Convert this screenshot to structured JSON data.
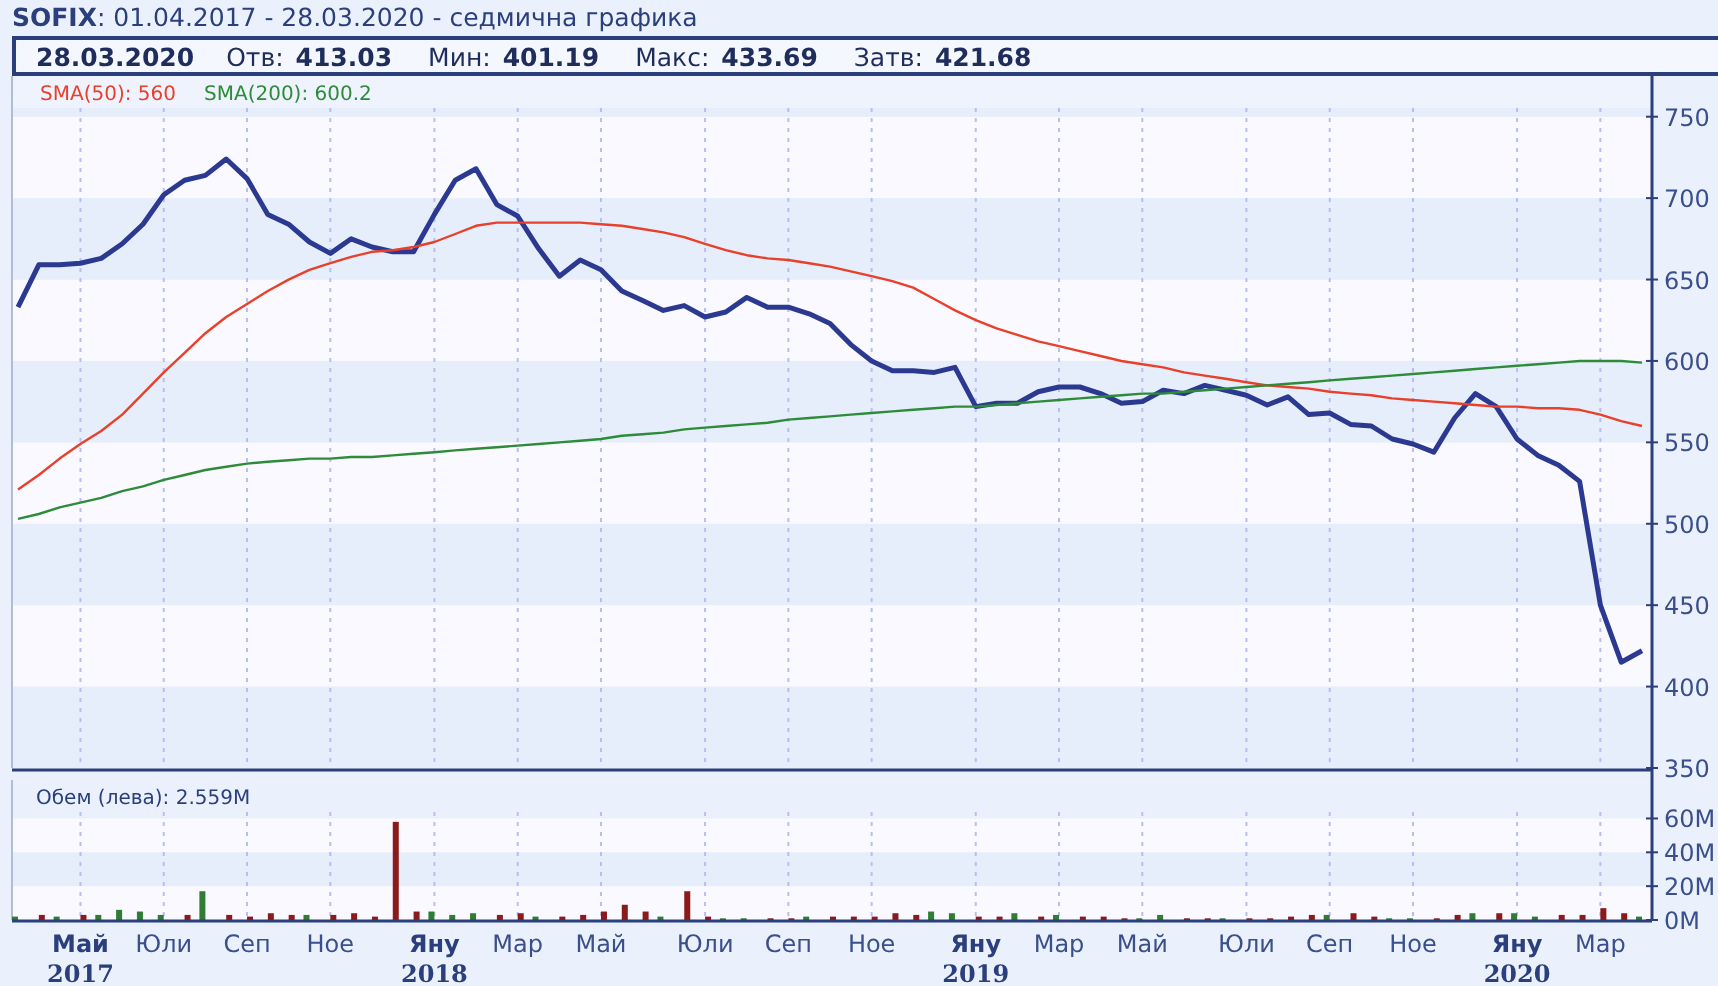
{
  "title": "**SOFIX**: 01.04.2017 - 28.03.2020 - седмична графика",
  "quote": {
    "date": "28.03.2020",
    "fields": [
      {
        "label": "Отв:",
        "value": "413.03"
      },
      {
        "label": "Мин:",
        "value": "401.19"
      },
      {
        "label": "Макс:",
        "value": "433.69"
      },
      {
        "label": "Затв:",
        "value": "421.68"
      }
    ]
  },
  "price_panel": {
    "legend": [
      {
        "text": "SMA(50): 560",
        "color": "#e8402a"
      },
      {
        "text": "SMA(200): 600.2",
        "color": "#2e8b3a"
      }
    ],
    "chart_data": {
      "type": "line",
      "grid": true,
      "ylim": [
        350,
        775
      ],
      "yticks": [
        350,
        400,
        450,
        500,
        550,
        600,
        650,
        700,
        750
      ],
      "series": [
        {
          "color": "#2b3990",
          "values": [
            633,
            659,
            659,
            660,
            663,
            672,
            684,
            702,
            711,
            714,
            724,
            712,
            690,
            684,
            673,
            666,
            675,
            670,
            667,
            667,
            690,
            711,
            718,
            696,
            689,
            669,
            652,
            662,
            656,
            643,
            637,
            631,
            634,
            627,
            630,
            639,
            633,
            633,
            629,
            623,
            610,
            600,
            594,
            594,
            593,
            596,
            572,
            574,
            574,
            581,
            584,
            584,
            580,
            574,
            575,
            582,
            580,
            585,
            582,
            579,
            573,
            578,
            567,
            568,
            561,
            560,
            552,
            549,
            544,
            565,
            580,
            572,
            552,
            542,
            536,
            526,
            450,
            415,
            422
          ]
        },
        {
          "color": "#e8402a",
          "values": [
            521,
            530,
            540,
            549,
            557,
            567,
            580,
            593,
            605,
            617,
            627,
            635,
            643,
            650,
            656,
            660,
            664,
            667,
            668,
            670,
            673,
            678,
            683,
            685,
            685,
            685,
            685,
            685,
            684,
            683,
            681,
            679,
            676,
            672,
            668,
            665,
            663,
            662,
            660,
            658,
            655,
            652,
            649,
            645,
            638,
            631,
            625,
            620,
            616,
            612,
            609,
            606,
            603,
            600,
            598,
            596,
            593,
            591,
            589,
            587,
            585,
            584,
            583,
            581,
            580,
            579,
            577,
            576,
            575,
            574,
            573,
            572,
            572,
            571,
            571,
            570,
            567,
            563,
            560
          ]
        },
        {
          "color": "#2e8b3a",
          "values": [
            503,
            506,
            510,
            513,
            516,
            520,
            523,
            527,
            530,
            533,
            535,
            537,
            538,
            539,
            540,
            540,
            541,
            541,
            542,
            543,
            544,
            545,
            546,
            547,
            548,
            549,
            550,
            551,
            552,
            554,
            555,
            556,
            558,
            559,
            560,
            561,
            562,
            564,
            565,
            566,
            567,
            568,
            569,
            570,
            571,
            572,
            572,
            573,
            574,
            575,
            576,
            577,
            578,
            579,
            580,
            580,
            581,
            582,
            583,
            584,
            585,
            586,
            587,
            588,
            589,
            590,
            591,
            592,
            593,
            594,
            595,
            596,
            597,
            598,
            599,
            600,
            600,
            600,
            599
          ]
        }
      ]
    }
  },
  "volume_panel": {
    "legend": "Обем (лева): 2.559M",
    "chart_data": {
      "type": "bar",
      "grid": true,
      "ylim": [
        0,
        65
      ],
      "yticks": [
        {
          "value": 0,
          "label": "0M"
        },
        {
          "value": 20,
          "label": "20M"
        },
        {
          "value": 40,
          "label": "40M"
        },
        {
          "value": 60,
          "label": "60M"
        }
      ],
      "categories": [
        null,
        null,
        null,
        "Май\n2017",
        null,
        null,
        null,
        "Юли",
        null,
        null,
        null,
        "Сеп",
        null,
        null,
        null,
        "Ное",
        null,
        null,
        null,
        null,
        "Яну\n2018",
        null,
        null,
        null,
        "Мар",
        null,
        null,
        null,
        "Май",
        null,
        null,
        null,
        null,
        "Юли",
        null,
        null,
        null,
        "Сеп",
        null,
        null,
        null,
        "Ное",
        null,
        null,
        null,
        null,
        "Яну\n2019",
        null,
        null,
        null,
        "Мар",
        null,
        null,
        null,
        "Май",
        null,
        null,
        null,
        null,
        "Юли",
        null,
        null,
        null,
        "Сеп",
        null,
        null,
        null,
        "Ное",
        null,
        null,
        null,
        null,
        "Яну\n2020",
        null,
        null,
        null,
        "Мар",
        null,
        null
      ],
      "series": [
        {
          "color": "#2e7d32",
          "values": [
            2,
            null,
            2,
            null,
            3,
            6,
            5,
            3,
            null,
            17,
            null,
            null,
            null,
            null,
            3,
            null,
            null,
            null,
            null,
            null,
            5,
            3,
            4,
            null,
            null,
            2,
            null,
            null,
            null,
            null,
            null,
            2,
            null,
            null,
            1,
            1,
            null,
            null,
            2,
            null,
            null,
            null,
            null,
            null,
            5,
            4,
            null,
            null,
            4,
            null,
            3,
            null,
            null,
            null,
            1,
            3,
            null,
            null,
            1,
            null,
            null,
            null,
            null,
            3,
            null,
            null,
            1,
            1,
            null,
            null,
            4,
            null,
            4,
            2,
            null,
            null,
            null,
            null,
            2
          ]
        },
        {
          "color": "#8b1a1a",
          "values": [
            null,
            3,
            null,
            3,
            null,
            null,
            null,
            null,
            3,
            null,
            3,
            2,
            4,
            3,
            null,
            3,
            4,
            2,
            58,
            5,
            null,
            null,
            null,
            3,
            4,
            null,
            2,
            3,
            5,
            9,
            5,
            null,
            17,
            2,
            null,
            null,
            1,
            1,
            null,
            2,
            2,
            2,
            4,
            3,
            null,
            null,
            2,
            2,
            null,
            2,
            null,
            2,
            2,
            1,
            null,
            null,
            1,
            1,
            null,
            1,
            1,
            2,
            3,
            null,
            4,
            2,
            null,
            null,
            1,
            3,
            null,
            4,
            null,
            null,
            3,
            3,
            7,
            4,
            null
          ]
        }
      ]
    }
  }
}
